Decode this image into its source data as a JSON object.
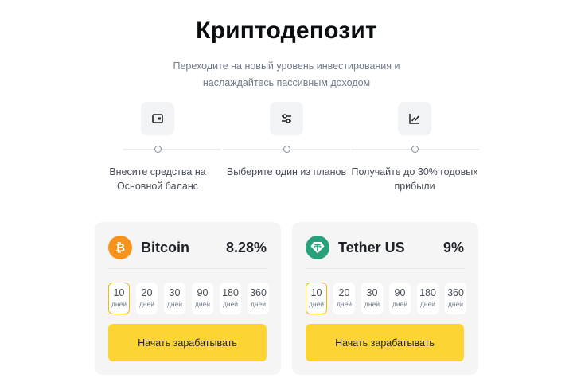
{
  "header": {
    "title": "Криптодепозит",
    "subtitle": "Переходите на новый уровень инвестирования и наслаждайтесь пассивным доходом"
  },
  "steps": [
    {
      "icon": "wallet-icon",
      "text": "Внесите средства на Основной баланс"
    },
    {
      "icon": "sliders-icon",
      "text": "Выберите один из планов"
    },
    {
      "icon": "line-chart-icon",
      "text": "Получайте до 30% годовых прибыли"
    }
  ],
  "plans": [
    {
      "coin_icon": "bitcoin-icon",
      "name": "Bitcoin",
      "rate": "8.28%",
      "color": "#f7931a",
      "days": [
        {
          "num": "10",
          "unit": "дней",
          "selected": true
        },
        {
          "num": "20",
          "unit": "дней"
        },
        {
          "num": "30",
          "unit": "дней"
        },
        {
          "num": "90",
          "unit": "дней"
        },
        {
          "num": "180",
          "unit": "дней"
        },
        {
          "num": "360",
          "unit": "дней"
        }
      ],
      "cta": "Начать зарабатывать"
    },
    {
      "coin_icon": "tether-icon",
      "name": "Tether US",
      "rate": "9%",
      "color": "#26a17b",
      "days": [
        {
          "num": "10",
          "unit": "дней",
          "selected": true
        },
        {
          "num": "20",
          "unit": "дней"
        },
        {
          "num": "30",
          "unit": "дней"
        },
        {
          "num": "90",
          "unit": "дней"
        },
        {
          "num": "180",
          "unit": "дней"
        },
        {
          "num": "360",
          "unit": "дней"
        }
      ],
      "cta": "Начать зарабатывать"
    }
  ],
  "colors": {
    "accent": "#fcd535",
    "selected_border": "#f0b90b",
    "card_bg": "#f5f5f5"
  }
}
